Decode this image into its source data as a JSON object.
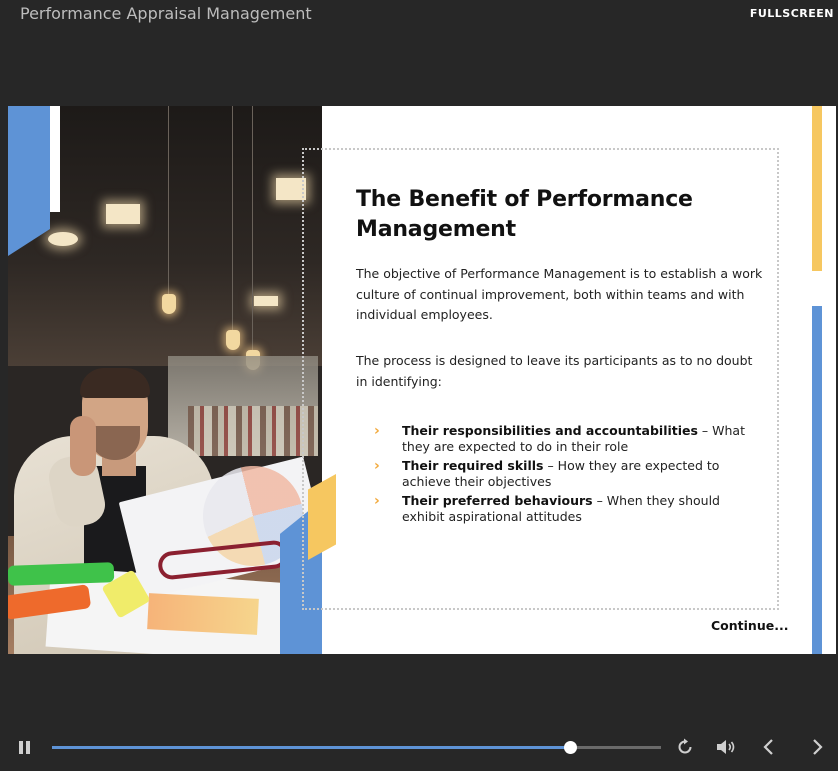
{
  "app": {
    "title": "Performance Appraisal Management",
    "fullscreen_label": "FULLSCREEN"
  },
  "slide": {
    "title": "The Benefit of Performance Management",
    "paragraph_1": "The objective of Performance Management is to establish a work culture of continual improvement, both within teams and with individual employees.",
    "paragraph_2": "The process is designed to leave its participants as to no doubt in identifying:",
    "bullets": [
      {
        "bold": "Their responsibilities and accountabilities",
        "rest": " – What they are expected to do in their role"
      },
      {
        "bold": "Their required skills",
        "rest": " – How they are expected to achieve their objectives"
      },
      {
        "bold": "Their preferred behaviours",
        "rest": " – When they should exhibit aspirational attitudes"
      }
    ],
    "bullet_icon": "chevron-right-icon",
    "continue_label": "Continue..."
  },
  "player": {
    "progress_fraction": 0.85,
    "icons": [
      "pause-icon",
      "replay-icon",
      "volume-icon",
      "previous-icon",
      "next-icon"
    ]
  },
  "colors": {
    "background": "#272727",
    "accent_blue": "#5e93d6",
    "accent_yellow": "#f6c760",
    "bullet_orange": "#f2a93b"
  }
}
